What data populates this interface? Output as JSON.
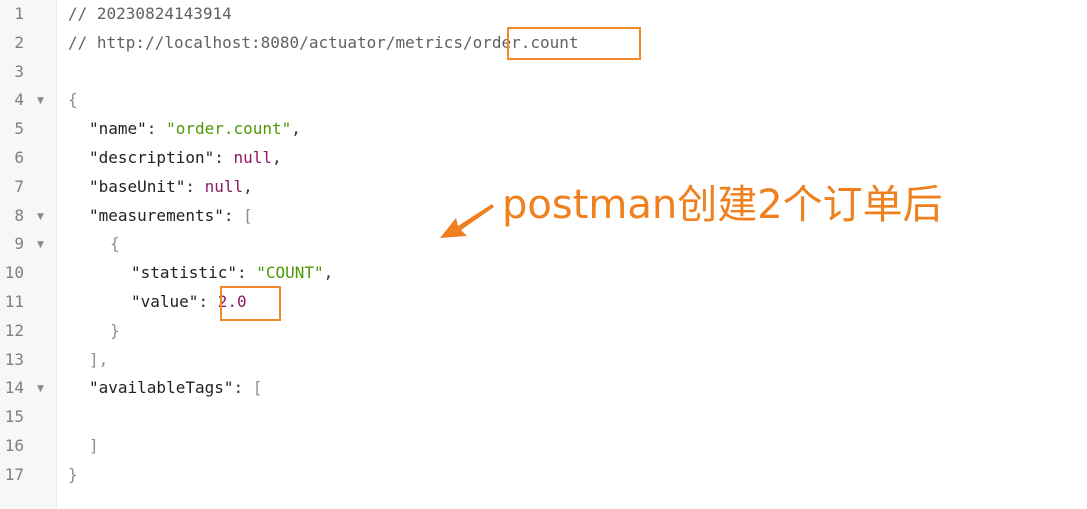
{
  "editor": {
    "lines": [
      {
        "n": "1",
        "fold": "",
        "indent": 0,
        "tokens": [
          {
            "t": "// 20230824143914",
            "c": "comment"
          }
        ]
      },
      {
        "n": "2",
        "fold": "",
        "indent": 0,
        "tokens": [
          {
            "t": "// http://localhost:8080/actuator/metrics/order.count",
            "c": "comment"
          }
        ]
      },
      {
        "n": "3",
        "fold": "",
        "indent": 0,
        "tokens": []
      },
      {
        "n": "4",
        "fold": "▼",
        "indent": 0,
        "tokens": [
          {
            "t": "{",
            "c": "bracket"
          }
        ]
      },
      {
        "n": "5",
        "fold": "",
        "indent": 2,
        "tokens": [
          {
            "t": "\"name\"",
            "c": "key"
          },
          {
            "t": ": ",
            "c": "punct"
          },
          {
            "t": "\"order.count\"",
            "c": "str"
          },
          {
            "t": ",",
            "c": "punct"
          }
        ]
      },
      {
        "n": "6",
        "fold": "",
        "indent": 2,
        "tokens": [
          {
            "t": "\"description\"",
            "c": "key"
          },
          {
            "t": ": ",
            "c": "punct"
          },
          {
            "t": "null",
            "c": "kw"
          },
          {
            "t": ",",
            "c": "punct"
          }
        ]
      },
      {
        "n": "7",
        "fold": "",
        "indent": 2,
        "tokens": [
          {
            "t": "\"baseUnit\"",
            "c": "key"
          },
          {
            "t": ": ",
            "c": "punct"
          },
          {
            "t": "null",
            "c": "kw"
          },
          {
            "t": ",",
            "c": "punct"
          }
        ]
      },
      {
        "n": "8",
        "fold": "▼",
        "indent": 2,
        "tokens": [
          {
            "t": "\"measurements\"",
            "c": "key"
          },
          {
            "t": ": ",
            "c": "punct"
          },
          {
            "t": "[",
            "c": "bracket"
          }
        ]
      },
      {
        "n": "9",
        "fold": "▼",
        "indent": 4,
        "tokens": [
          {
            "t": "{",
            "c": "bracket"
          }
        ]
      },
      {
        "n": "10",
        "fold": "",
        "indent": 6,
        "tokens": [
          {
            "t": "\"statistic\"",
            "c": "key"
          },
          {
            "t": ": ",
            "c": "punct"
          },
          {
            "t": "\"COUNT\"",
            "c": "str"
          },
          {
            "t": ",",
            "c": "punct"
          }
        ]
      },
      {
        "n": "11",
        "fold": "",
        "indent": 6,
        "tokens": [
          {
            "t": "\"value\"",
            "c": "key"
          },
          {
            "t": ": ",
            "c": "punct"
          },
          {
            "t": "2.0",
            "c": "num"
          }
        ]
      },
      {
        "n": "12",
        "fold": "",
        "indent": 4,
        "tokens": [
          {
            "t": "}",
            "c": "bracket"
          }
        ]
      },
      {
        "n": "13",
        "fold": "",
        "indent": 2,
        "tokens": [
          {
            "t": "],",
            "c": "bracket"
          }
        ]
      },
      {
        "n": "14",
        "fold": "▼",
        "indent": 2,
        "tokens": [
          {
            "t": "\"availableTags\"",
            "c": "key"
          },
          {
            "t": ": ",
            "c": "punct"
          },
          {
            "t": "[",
            "c": "bracket"
          }
        ]
      },
      {
        "n": "15",
        "fold": "",
        "indent": 0,
        "tokens": []
      },
      {
        "n": "16",
        "fold": "",
        "indent": 2,
        "tokens": [
          {
            "t": "]",
            "c": "bracket"
          }
        ]
      },
      {
        "n": "17",
        "fold": "",
        "indent": 0,
        "tokens": [
          {
            "t": "}",
            "c": "bracket"
          }
        ]
      }
    ]
  },
  "annotation": {
    "text": "postman创建2个订单后",
    "color": "#f0801e"
  },
  "colors": {
    "highlight_box": "#f08a2a",
    "string": "#4e9a06",
    "keyword": "#8a1a62",
    "comment": "#616161"
  }
}
